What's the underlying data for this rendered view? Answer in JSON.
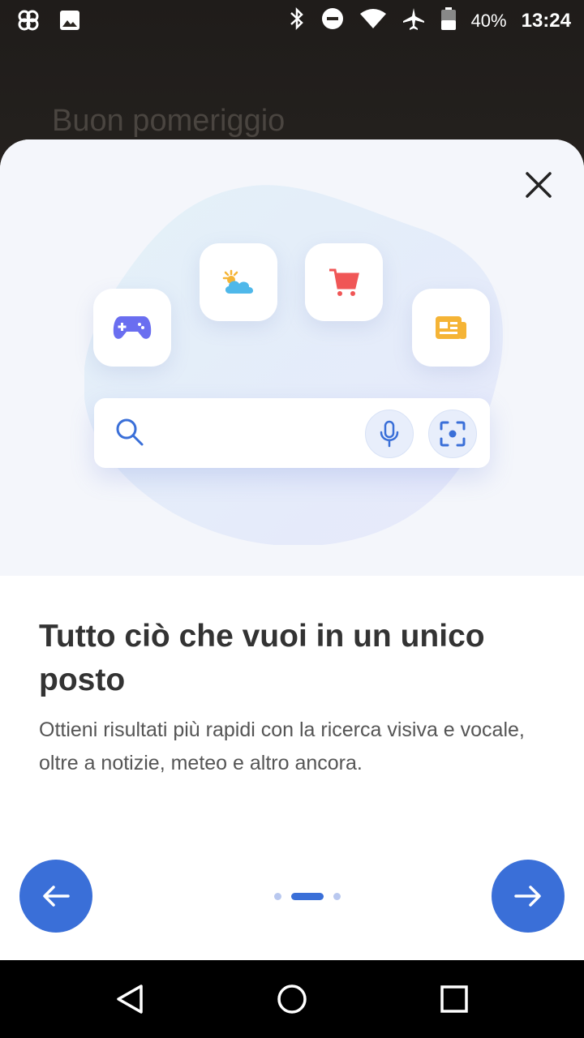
{
  "status_bar": {
    "battery": "40%",
    "time": "13:24"
  },
  "background": {
    "greeting": "Buon pomeriggio"
  },
  "onboarding": {
    "title": "Tutto ciò che vuoi in un unico posto",
    "description": "Ottieni risultati più rapidi con la ricerca visiva e vocale, oltre a notizie, meteo e altro ancora.",
    "page_index": 2,
    "page_count": 3
  },
  "icons": {
    "close": "close-icon",
    "tiles": [
      "gamepad-icon",
      "weather-icon",
      "shopping-cart-icon",
      "news-icon"
    ],
    "search": "search-icon",
    "mic": "mic-icon",
    "lens": "visual-search-icon",
    "back": "arrow-left-icon",
    "next": "arrow-right-icon"
  },
  "colors": {
    "accent": "#3a6fd8",
    "game": "#6a6ef0",
    "weather": "#4fb8ea",
    "cart": "#f05656",
    "news": "#f5b436"
  }
}
